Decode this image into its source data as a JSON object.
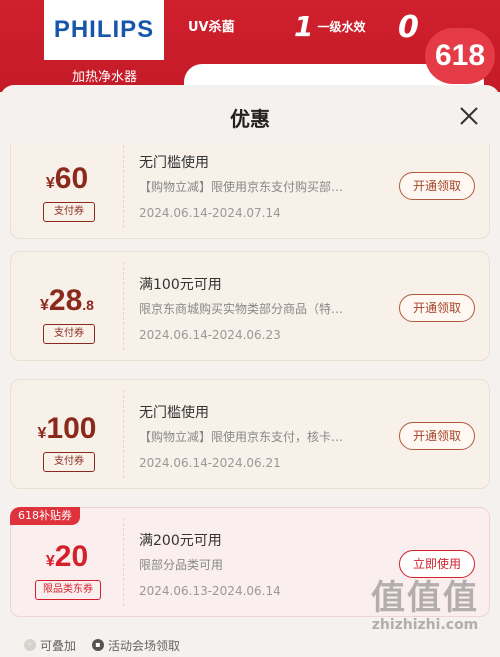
{
  "banner": {
    "brand": "PHILIPS",
    "product": "加热净水器",
    "uv_badge": "UV杀菌",
    "water_badge_num": "1",
    "water_badge_text": "一级水效",
    "zero_badge": "0",
    "promo": "618"
  },
  "sheet": {
    "title": "优惠"
  },
  "coupons": [
    {
      "currency": "¥",
      "amount": "60",
      "amount_decimal": "",
      "type": "支付券",
      "condition": "无门槛使用",
      "description": "【购物立减】限使用京东支付购买部…",
      "dates": "2024.06.14-2024.07.14",
      "action": "开通领取"
    },
    {
      "currency": "¥",
      "amount": "28",
      "amount_decimal": ".8",
      "type": "支付券",
      "condition": "满100元可用",
      "description": "限京东商城购买实物类部分商品（特…",
      "dates": "2024.06.14-2024.06.23",
      "action": "开通领取"
    },
    {
      "currency": "¥",
      "amount": "100",
      "amount_decimal": "",
      "type": "支付券",
      "condition": "无门槛使用",
      "description": "【购物立减】限使用京东支付，核卡…",
      "dates": "2024.06.14-2024.06.21",
      "action": "开通领取"
    },
    {
      "ribbon": "618补贴券",
      "currency": "¥",
      "amount": "20",
      "amount_decimal": "",
      "type": "限品类东券",
      "condition": "满200元可用",
      "description": "限部分品类可用",
      "dates": "2024.06.13-2024.06.14",
      "action": "立即使用"
    }
  ],
  "footer": {
    "stackable": "可叠加",
    "venue": "活动会场领取"
  },
  "watermark": {
    "glyphs": "值值值",
    "url": "zhizhizhi.com"
  },
  "colors": {
    "banner_red": "#c41a27",
    "coupon_brown": "#8b2a1c",
    "coupon_red": "#d4202b"
  }
}
